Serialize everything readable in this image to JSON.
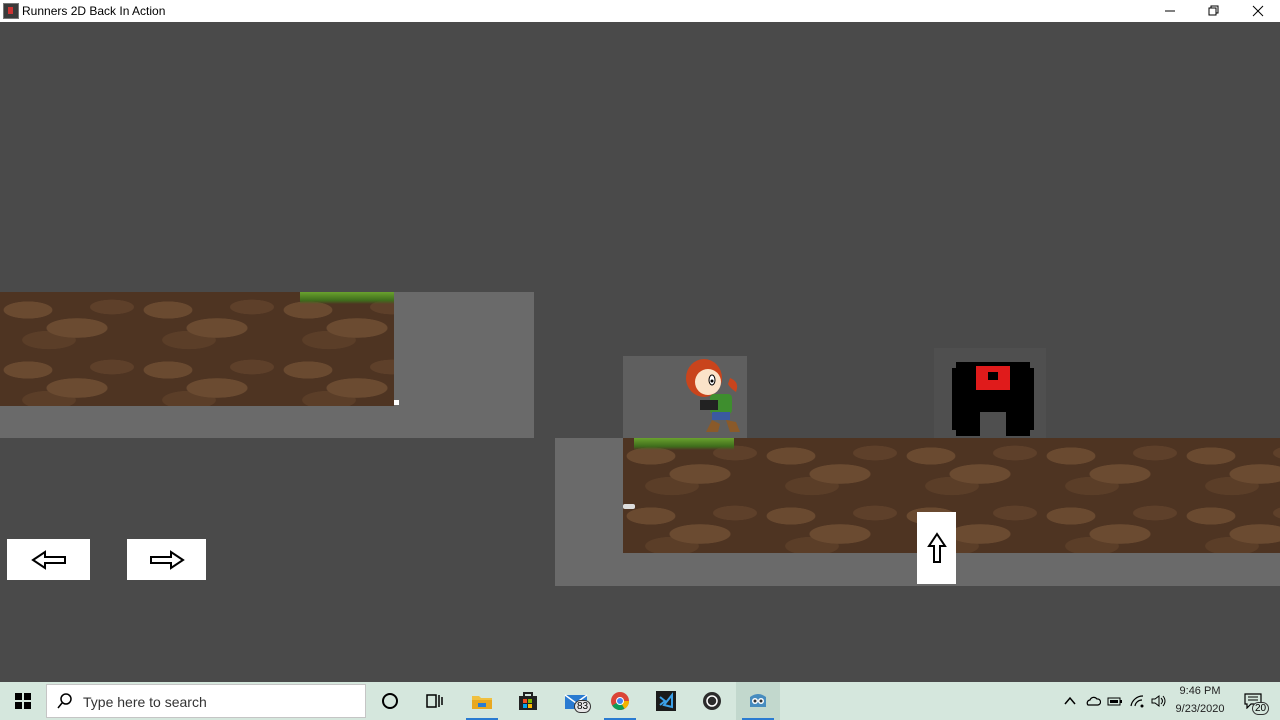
{
  "window": {
    "title": "Runners 2D Back In Action",
    "controls": [
      "minimize",
      "restore",
      "close"
    ]
  },
  "game": {
    "background": "#4a4a4a",
    "platform_color": "#6a6a6a",
    "controls": {
      "left": "left-arrow-icon",
      "right": "right-arrow-icon",
      "jump": "up-arrow-icon"
    },
    "enemy_eye_color": "#e01b1b"
  },
  "taskbar": {
    "search_placeholder": "Type here to search",
    "mail_badge": "83",
    "notification_badge": "20",
    "time": "9:46 PM",
    "date": "9/23/2020",
    "icons": [
      "windows-start-icon",
      "search-icon",
      "cortana-icon",
      "task-view-icon",
      "file-explorer-icon",
      "store-icon",
      "mail-icon",
      "chrome-icon",
      "visual-studio-icon",
      "obs-icon",
      "godot-icon"
    ]
  }
}
